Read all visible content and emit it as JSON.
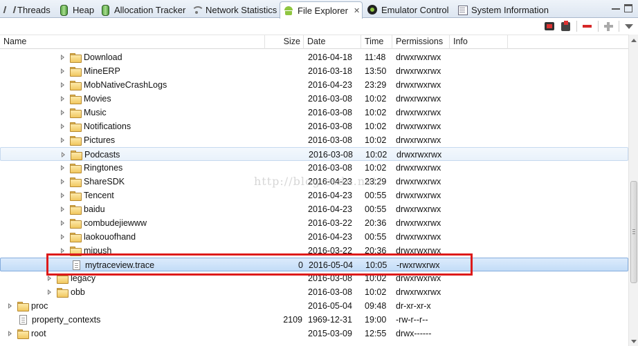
{
  "tabs": [
    {
      "label": "Threads",
      "icon": "threads-icon",
      "active": false
    },
    {
      "label": "Heap",
      "icon": "heap-icon",
      "active": false
    },
    {
      "label": "Allocation Tracker",
      "icon": "allocation-tracker-icon",
      "active": false
    },
    {
      "label": "Network Statistics",
      "icon": "network-icon",
      "active": false
    },
    {
      "label": "File Explorer",
      "icon": "android-icon",
      "active": true
    },
    {
      "label": "Emulator Control",
      "icon": "emulator-icon",
      "active": false
    },
    {
      "label": "System Information",
      "icon": "system-information-icon",
      "active": false
    }
  ],
  "toolbar": {
    "buttons": [
      "pull-file-icon",
      "push-file-icon",
      "delete-icon",
      "new-folder-icon",
      "view-menu-icon"
    ]
  },
  "columns": {
    "name": "Name",
    "size": "Size",
    "date": "Date",
    "time": "Time",
    "permissions": "Permissions",
    "info": "Info"
  },
  "rows": [
    {
      "name": "Download",
      "type": "folder",
      "level": 4,
      "size": "",
      "date": "2016-04-18",
      "time": "11:48",
      "permissions": "drwxrwxrwx"
    },
    {
      "name": "MineERP",
      "type": "folder",
      "level": 4,
      "size": "",
      "date": "2016-03-18",
      "time": "13:50",
      "permissions": "drwxrwxrwx"
    },
    {
      "name": "MobNativeCrashLogs",
      "type": "folder",
      "level": 4,
      "size": "",
      "date": "2016-04-23",
      "time": "23:29",
      "permissions": "drwxrwxrwx"
    },
    {
      "name": "Movies",
      "type": "folder",
      "level": 4,
      "size": "",
      "date": "2016-03-08",
      "time": "10:02",
      "permissions": "drwxrwxrwx"
    },
    {
      "name": "Music",
      "type": "folder",
      "level": 4,
      "size": "",
      "date": "2016-03-08",
      "time": "10:02",
      "permissions": "drwxrwxrwx"
    },
    {
      "name": "Notifications",
      "type": "folder",
      "level": 4,
      "size": "",
      "date": "2016-03-08",
      "time": "10:02",
      "permissions": "drwxrwxrwx"
    },
    {
      "name": "Pictures",
      "type": "folder",
      "level": 4,
      "size": "",
      "date": "2016-03-08",
      "time": "10:02",
      "permissions": "drwxrwxrwx"
    },
    {
      "name": "Podcasts",
      "type": "folder",
      "level": 4,
      "size": "",
      "date": "2016-03-08",
      "time": "10:02",
      "permissions": "drwxrwxrwx",
      "state": "hover"
    },
    {
      "name": "Ringtones",
      "type": "folder",
      "level": 4,
      "size": "",
      "date": "2016-03-08",
      "time": "10:02",
      "permissions": "drwxrwxrwx"
    },
    {
      "name": "ShareSDK",
      "type": "folder",
      "level": 4,
      "size": "",
      "date": "2016-04-23",
      "time": "23:29",
      "permissions": "drwxrwxrwx"
    },
    {
      "name": "Tencent",
      "type": "folder",
      "level": 4,
      "size": "",
      "date": "2016-04-23",
      "time": "00:55",
      "permissions": "drwxrwxrwx"
    },
    {
      "name": "baidu",
      "type": "folder",
      "level": 4,
      "size": "",
      "date": "2016-04-23",
      "time": "00:55",
      "permissions": "drwxrwxrwx"
    },
    {
      "name": "combudejiewww",
      "type": "folder",
      "level": 4,
      "size": "",
      "date": "2016-03-22",
      "time": "20:36",
      "permissions": "drwxrwxrwx"
    },
    {
      "name": "laokouofhand",
      "type": "folder",
      "level": 4,
      "size": "",
      "date": "2016-04-23",
      "time": "00:55",
      "permissions": "drwxrwxrwx"
    },
    {
      "name": "mipush",
      "type": "folder",
      "level": 4,
      "size": "",
      "date": "2016-03-22",
      "time": "20:36",
      "permissions": "drwxrwxrwx"
    },
    {
      "name": "mytraceview.trace",
      "type": "file",
      "level": 4,
      "size": "0",
      "date": "2016-05-04",
      "time": "10:05",
      "permissions": "-rwxrwxrwx",
      "state": "selected"
    },
    {
      "name": "legacy",
      "type": "folder",
      "level": 3,
      "size": "",
      "date": "2016-03-08",
      "time": "10:02",
      "permissions": "drwxrwxrwx"
    },
    {
      "name": "obb",
      "type": "folder",
      "level": 3,
      "size": "",
      "date": "2016-03-08",
      "time": "10:02",
      "permissions": "drwxrwxrwx"
    },
    {
      "name": "proc",
      "type": "folder",
      "level": 0,
      "size": "",
      "date": "2016-05-04",
      "time": "09:48",
      "permissions": "dr-xr-xr-x"
    },
    {
      "name": "property_contexts",
      "type": "file",
      "level": 0,
      "size": "2109",
      "date": "1969-12-31",
      "time": "19:00",
      "permissions": "-rw-r--r--"
    },
    {
      "name": "root",
      "type": "folder",
      "level": 0,
      "size": "",
      "date": "2015-03-09",
      "time": "12:55",
      "permissions": "drwx------"
    }
  ],
  "watermark": "http://blog.csdn.net/"
}
